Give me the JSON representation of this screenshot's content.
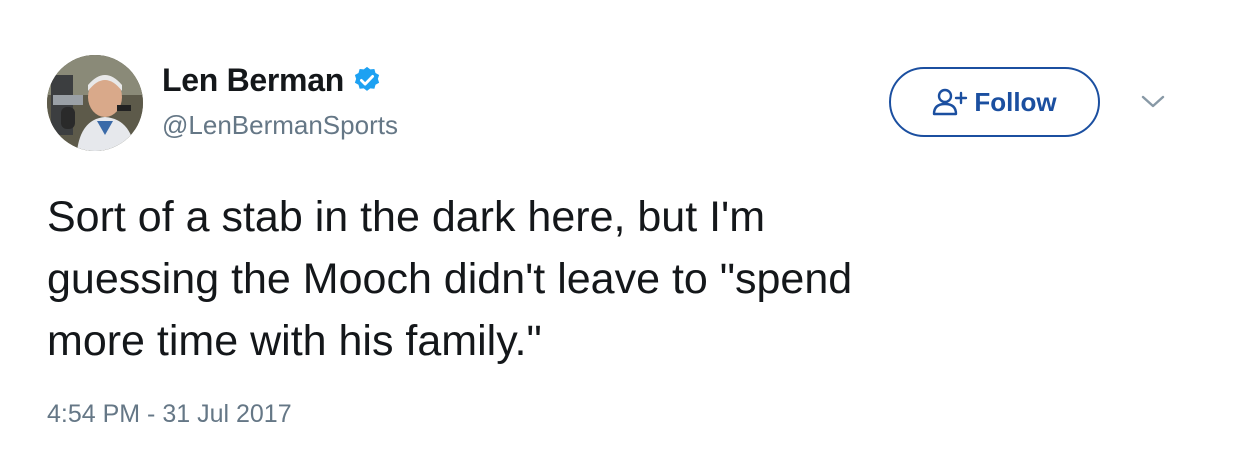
{
  "tweet": {
    "author": {
      "display_name": "Len Berman",
      "handle": "@LenBermanSports",
      "verified": true,
      "avatar_icon": "profile-photo"
    },
    "follow_button": {
      "label": "Follow",
      "icon": "add-user-icon",
      "color": "#1b4fa0"
    },
    "menu_icon": "chevron-down-icon",
    "text": "Sort of a stab in the dark here, but I'm\nguessing the Mooch didn't leave to \"spend\nmore time with his family.\"",
    "timestamp": "4:54 PM - 31 Jul 2017"
  },
  "colors": {
    "verified_badge": "#1da1f2",
    "secondary_text": "#657786",
    "primary_text": "#14171a"
  }
}
